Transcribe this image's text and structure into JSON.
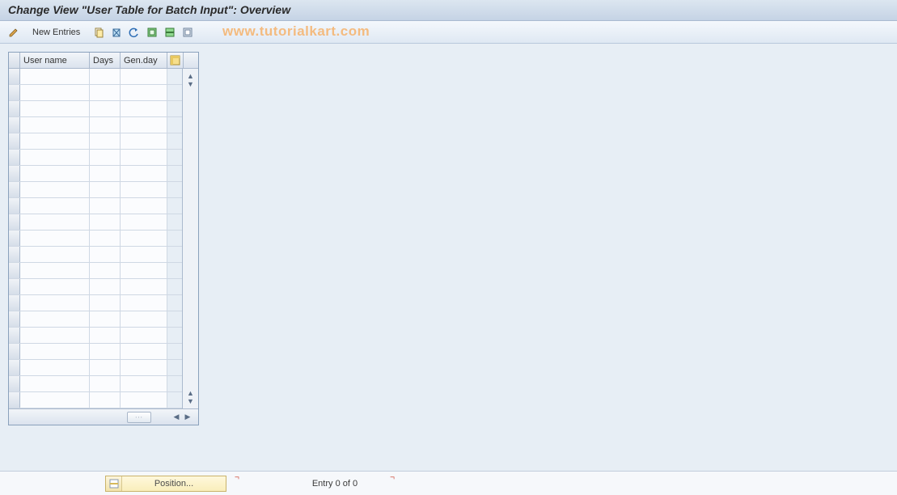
{
  "title": "Change View \"User Table for Batch Input\": Overview",
  "toolbar": {
    "new_entries_label": "New Entries"
  },
  "watermark": "www.tutorialkart.com",
  "table": {
    "columns": {
      "user": "User name",
      "days": "Days",
      "genday": "Gen.day"
    },
    "row_count": 21
  },
  "footer": {
    "position_label": "Position...",
    "entry_text": "Entry 0 of 0"
  }
}
